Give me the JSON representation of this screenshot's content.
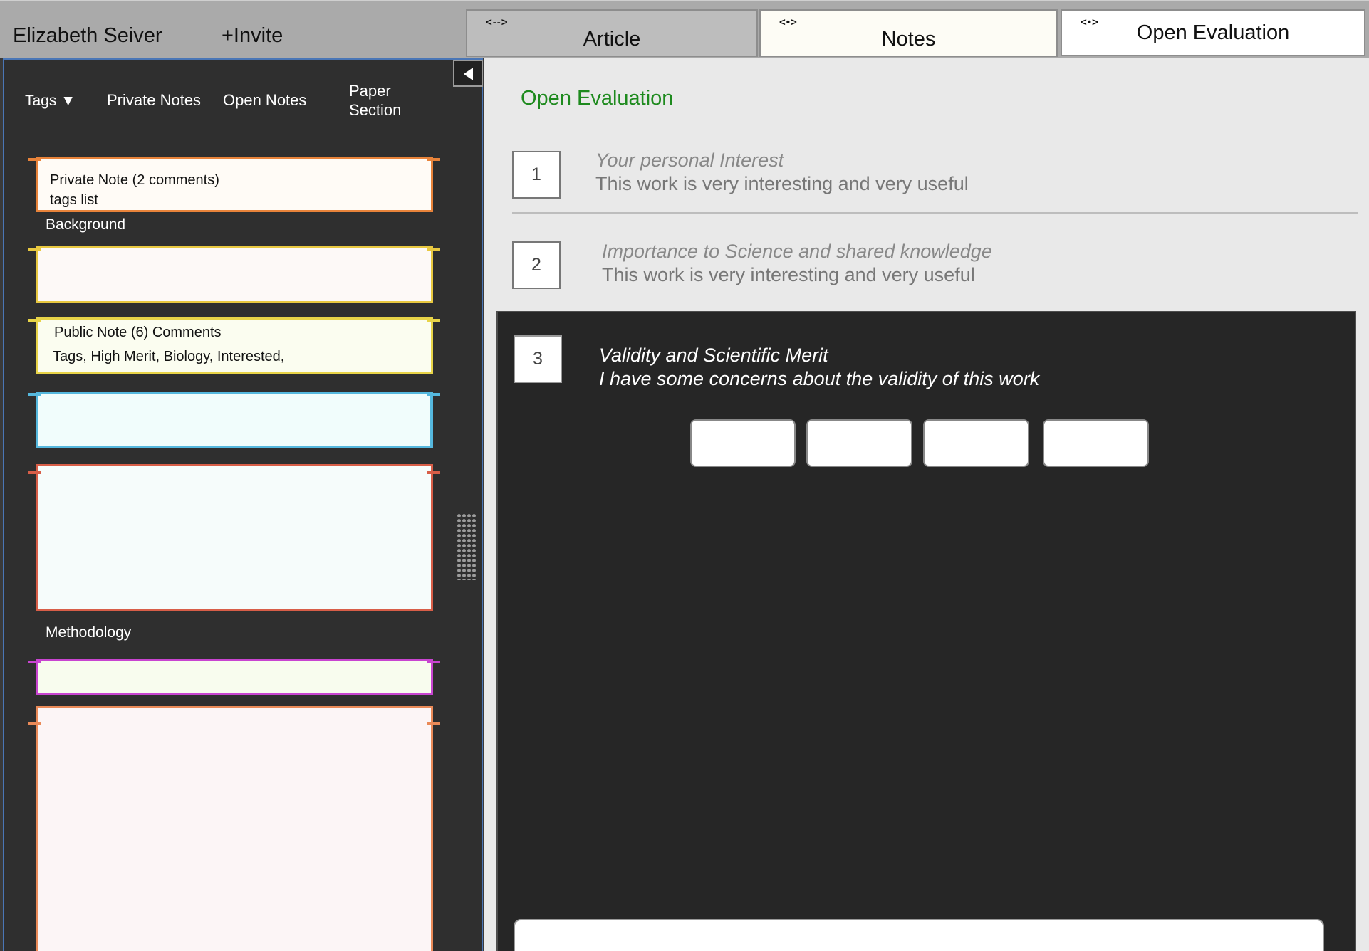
{
  "header": {
    "user_name": "Elizabeth Seiver",
    "invite_label": "+Invite",
    "tabs": [
      {
        "arrows": "<-->",
        "label": "Article"
      },
      {
        "arrows": "<•>",
        "label": "Notes"
      },
      {
        "arrows": "<•>",
        "label": "Open Evaluation"
      }
    ]
  },
  "sidebar": {
    "filters": {
      "tags": "Tags ▼",
      "private_notes": "Private Notes",
      "open_notes": "Open Notes",
      "paper_section_line1": "Paper",
      "paper_section_line2": "Section"
    },
    "notes": [
      {
        "line1": "Private Note (2 comments)",
        "line2": "tags list",
        "border": "#e8833a",
        "fill": "#fffbf6"
      },
      {
        "line1": "",
        "line2": "",
        "border": "#e8c840",
        "fill": "#fdf9f7"
      },
      {
        "line1": "Public Note (6) Comments",
        "line2": "Tags, High Merit, Biology, Interested,",
        "border": "#e8d448",
        "fill": "#fbfdf0"
      },
      {
        "line1": "",
        "line2": "",
        "border": "#55b8de",
        "fill": "#f1fdfc"
      },
      {
        "line1": "",
        "line2": "",
        "border": "#d85e48",
        "fill": "#f6fcfb"
      },
      {
        "line1": "",
        "line2": "",
        "border": "#c844d0",
        "fill": "#f8fcee"
      },
      {
        "line1": "",
        "line2": "",
        "border": "#ea8a58",
        "fill": "#fcf5f6"
      }
    ],
    "sections": {
      "background": "Background",
      "methodology": "Methodology"
    }
  },
  "evaluation": {
    "title": "Open Evaluation",
    "questions": [
      {
        "number": "1",
        "title": "Your personal Interest",
        "answer": "This work is very interesting and very useful"
      },
      {
        "number": "2",
        "title": "Importance to Science and shared knowledge",
        "answer": "This work is very interesting and very useful"
      },
      {
        "number": "3",
        "title": "Validity and Scientific Merit",
        "answer": "I have some concerns about the validity of this work"
      }
    ]
  },
  "colors": {
    "accent_green": "#1e8a1e",
    "panel_border_blue": "#4a76b6"
  }
}
